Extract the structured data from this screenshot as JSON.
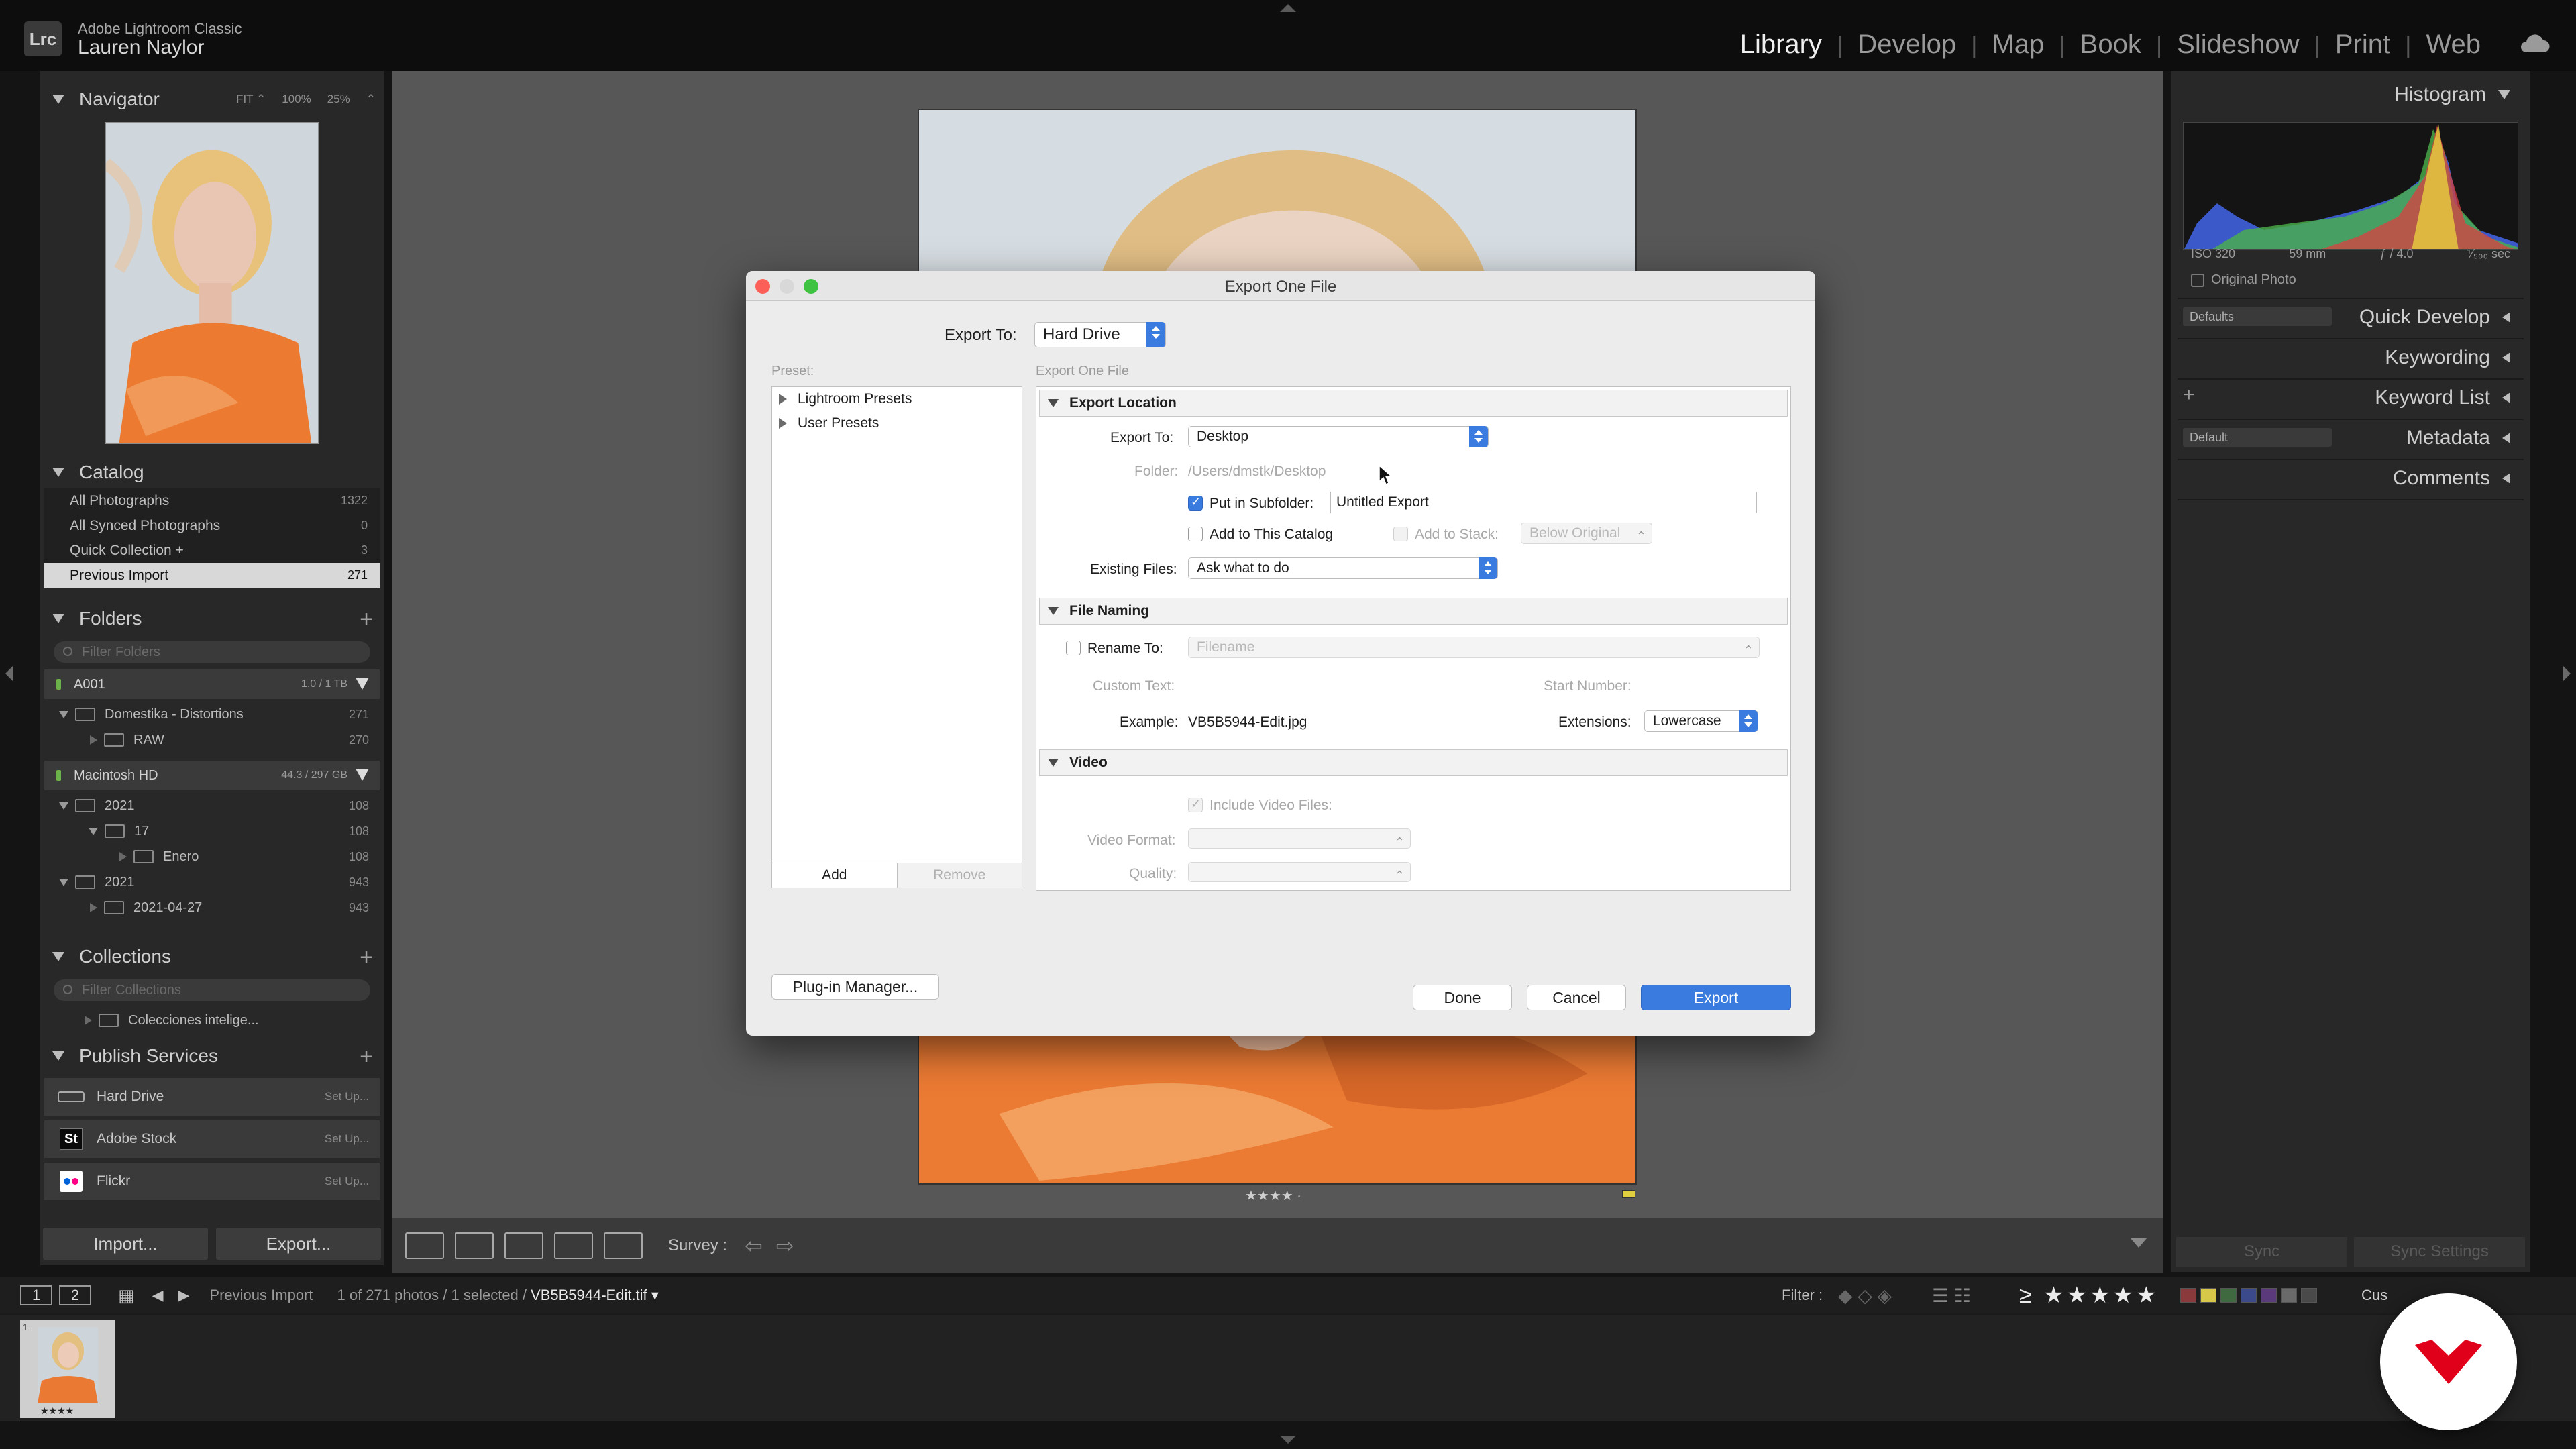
{
  "app": {
    "logo": "Lrc",
    "name": "Adobe Lightroom Classic",
    "user": "Lauren Naylor",
    "modules": [
      "Library",
      "Develop",
      "Map",
      "Book",
      "Slideshow",
      "Print",
      "Web"
    ],
    "active_module": "Library"
  },
  "left": {
    "navigator": {
      "title": "Navigator",
      "zoom": [
        "FIT ⌃",
        "100%",
        "25%",
        "⌃"
      ]
    },
    "catalog": {
      "title": "Catalog",
      "items": [
        {
          "label": "All Photographs",
          "count": "1322"
        },
        {
          "label": "All Synced Photographs",
          "count": "0"
        },
        {
          "label": "Quick Collection +",
          "count": "3"
        },
        {
          "label": "Previous Import",
          "count": "271"
        }
      ]
    },
    "folders": {
      "title": "Folders",
      "search_placeholder": "Filter Folders",
      "volumes": [
        {
          "label": "A001",
          "size": "1.0 / 1 TB"
        },
        {
          "label": "Macintosh HD",
          "size": "44.3 / 297 GB"
        }
      ],
      "rows": [
        {
          "label": "Domestika - Distortions",
          "count": "271"
        },
        {
          "label": "RAW",
          "count": "270"
        },
        {
          "label": "2021",
          "count": "108"
        },
        {
          "label": "17",
          "count": "108"
        },
        {
          "label": "Enero",
          "count": "108"
        },
        {
          "label": "2021",
          "count": "943"
        },
        {
          "label": "2021-04-27",
          "count": "943"
        }
      ]
    },
    "collections": {
      "title": "Collections",
      "search_placeholder": "Filter Collections",
      "items": [
        "Colecciones intelige..."
      ]
    },
    "publish": {
      "title": "Publish Services",
      "services": [
        {
          "label": "Hard Drive",
          "action": "Set Up..."
        },
        {
          "label": "Adobe Stock",
          "action": "Set Up...",
          "icon_text": "St"
        },
        {
          "label": "Flickr",
          "action": "Set Up..."
        }
      ]
    },
    "buttons": {
      "import": "Import...",
      "export": "Export..."
    }
  },
  "center": {
    "rating": "★★★★ ·",
    "toolbar": {
      "survey": "Survey :"
    }
  },
  "right": {
    "histogram": {
      "title": "Histogram",
      "iso": "ISO 320",
      "focal": "59 mm",
      "aperture": "ƒ / 4.0",
      "shutter": "¹⁄₅₀₀ sec",
      "original_photo": "Original Photo"
    },
    "quick_develop": {
      "title": "Quick Develop",
      "preset": "Defaults"
    },
    "keywording": "Keywording",
    "keyword_list": "Keyword List",
    "metadata": {
      "title": "Metadata",
      "preset": "Default"
    },
    "comments": "Comments",
    "sync": "Sync",
    "sync_settings": "Sync Settings"
  },
  "filmstrip": {
    "screen1": "1",
    "screen2": "2",
    "source": "Previous Import",
    "count": "1 of 271 photos / 1 selected /",
    "filename": "VB5B5944-Edit.tif ▾",
    "filter_label": "Filter :",
    "filter_stars": "≥ ★★★★★",
    "custom": "Cus",
    "thumb_rating": "★★★★",
    "thumb_index": "1"
  },
  "dialog": {
    "title": "Export One File",
    "export_to_label": "Export To:",
    "export_to_value": "Hard Drive",
    "preset_label": "Preset:",
    "presets": [
      "Lightroom Presets",
      "User Presets"
    ],
    "add": "Add",
    "remove": "Remove",
    "subtitle": "Export One File",
    "location": {
      "header": "Export Location",
      "export_to_label": "Export To:",
      "export_to_value": "Desktop",
      "folder_label": "Folder:",
      "folder_value": "/Users/dmstk/Desktop",
      "subfolder_label": "Put in Subfolder:",
      "subfolder_value": "Untitled Export",
      "add_catalog": "Add to This Catalog",
      "add_stack": "Add to Stack:",
      "stack_value": "Below Original",
      "existing_label": "Existing Files:",
      "existing_value": "Ask what to do"
    },
    "naming": {
      "header": "File Naming",
      "rename_label": "Rename To:",
      "rename_value": "Filename",
      "custom_text": "Custom Text:",
      "start_number": "Start Number:",
      "example_label": "Example:",
      "example_value": "VB5B5944-Edit.jpg",
      "extensions_label": "Extensions:",
      "extensions_value": "Lowercase"
    },
    "video": {
      "header": "Video",
      "include": "Include Video Files:",
      "format": "Video Format:",
      "quality": "Quality:"
    },
    "plugin_manager": "Plug-in Manager...",
    "done": "Done",
    "cancel": "Cancel",
    "export": "Export"
  },
  "colors": {
    "accent": "#3a7be0",
    "brand_badge": "#e1001a"
  }
}
